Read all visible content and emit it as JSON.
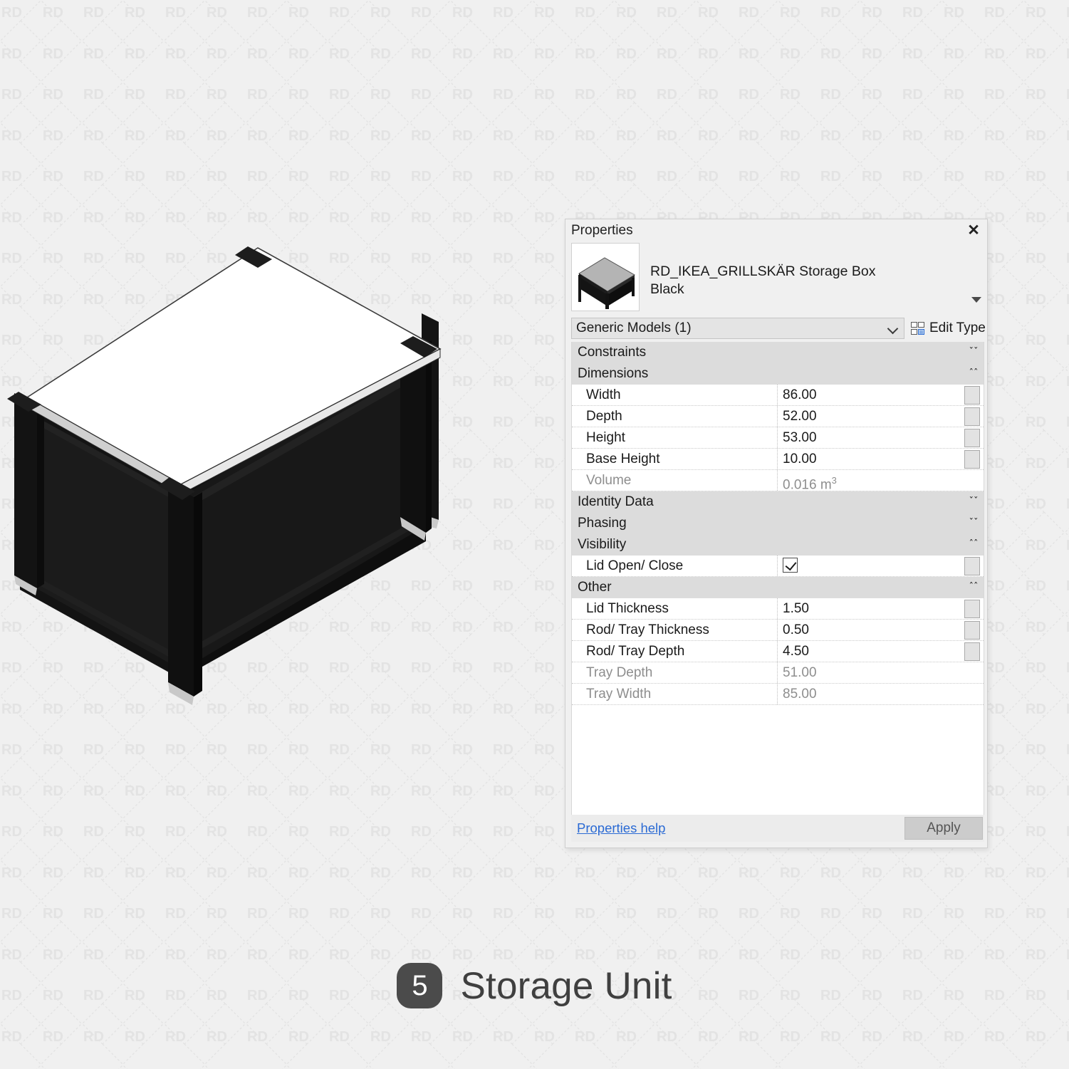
{
  "watermark": {
    "text": "RD"
  },
  "caption": {
    "number": "5",
    "title": "Storage Unit"
  },
  "panel": {
    "title": "Properties",
    "close_icon": "close-icon",
    "element": {
      "name_line1": "RD_IKEA_GRILLSKÄR Storage Box",
      "name_line2": "Black",
      "thumbnail_icon": "storage-box-thumbnail"
    },
    "type_selector": {
      "value": "Generic Models (1)",
      "caret_icon": "chevron-down-icon"
    },
    "edit_type": {
      "label": "Edit Type",
      "icon": "edit-type-icon"
    },
    "groups": [
      {
        "label": "Constraints",
        "state_icon": "chevron-double-down-icon",
        "glyph": "ˇˇ",
        "rows": []
      },
      {
        "label": "Dimensions",
        "state_icon": "chevron-double-up-icon",
        "glyph": "ˆˆ",
        "rows": [
          {
            "name": "Width",
            "value": "86.00",
            "readonly": false,
            "button": true,
            "type": "text"
          },
          {
            "name": "Depth",
            "value": "52.00",
            "readonly": false,
            "button": true,
            "type": "text"
          },
          {
            "name": "Height",
            "value": "53.00",
            "readonly": false,
            "button": true,
            "type": "text"
          },
          {
            "name": "Base Height",
            "value": "10.00",
            "readonly": false,
            "button": true,
            "type": "text"
          },
          {
            "name": "Volume",
            "value": "0.016 m",
            "sup": "3",
            "readonly": true,
            "button": false,
            "type": "text"
          }
        ]
      },
      {
        "label": "Identity Data",
        "state_icon": "chevron-double-down-icon",
        "glyph": "ˇˇ",
        "rows": []
      },
      {
        "label": "Phasing",
        "state_icon": "chevron-double-down-icon",
        "glyph": "ˇˇ",
        "rows": []
      },
      {
        "label": "Visibility",
        "state_icon": "chevron-double-up-icon",
        "glyph": "ˆˆ",
        "rows": [
          {
            "name": "Lid Open/ Close",
            "value": "",
            "readonly": false,
            "button": true,
            "type": "checkbox",
            "checked": true
          }
        ]
      },
      {
        "label": "Other",
        "state_icon": "chevron-double-up-icon",
        "glyph": "ˆˆ",
        "rows": [
          {
            "name": "Lid Thickness",
            "value": "1.50",
            "readonly": false,
            "button": true,
            "type": "text"
          },
          {
            "name": "Rod/ Tray Thickness",
            "value": "0.50",
            "readonly": false,
            "button": true,
            "type": "text"
          },
          {
            "name": "Rod/ Tray Depth",
            "value": "4.50",
            "readonly": false,
            "button": true,
            "type": "text"
          },
          {
            "name": "Tray Depth",
            "value": "51.00",
            "readonly": true,
            "button": false,
            "type": "text"
          },
          {
            "name": "Tray Width",
            "value": "85.00",
            "readonly": true,
            "button": false,
            "type": "text"
          }
        ]
      }
    ],
    "footer": {
      "help_link": "Properties help",
      "apply_label": "Apply"
    }
  },
  "colors": {
    "page_background": "#f0f0f0",
    "panel_background": "#f0f0f0",
    "group_header": "#dcdcdc",
    "row_background": "#ffffff",
    "link_blue": "#2a6ad4",
    "model_body": "#141414",
    "model_lid": "#ffffff",
    "caption_badge": "#4b4b4b",
    "caption_text": "#3f3f3f"
  }
}
